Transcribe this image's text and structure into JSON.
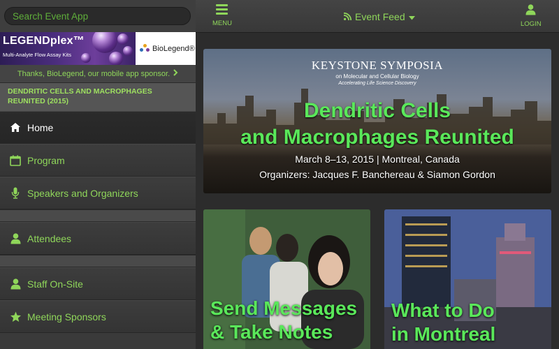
{
  "sidebar": {
    "search": {
      "placeholder": "Search Event App"
    },
    "sponsor": {
      "brand": "LEGENDplex™",
      "tagline": "Multi-Analyte Flow Assay Kits",
      "company": "BioLegend®",
      "thanks": "Thanks, BioLegend, our mobile app sponsor.",
      "thanks_icon": "chevron-right-icon"
    },
    "event_title": "DENDRITIC CELLS AND MACROPHAGES REUNITED (2015)",
    "nav": [
      {
        "label": "Home",
        "icon": "home-icon",
        "active": true
      },
      {
        "label": "Program",
        "icon": "calendar-icon"
      },
      {
        "label": "Speakers and Organizers",
        "icon": "microphone-icon"
      },
      {
        "label": "Attendees",
        "icon": "person-icon"
      },
      {
        "label": "Staff On-Site",
        "icon": "person-icon"
      },
      {
        "label": "Meeting Sponsors",
        "icon": "star-icon"
      }
    ]
  },
  "topbar": {
    "menu_label": "MENU",
    "feed_label": "Event Feed",
    "login_label": "LOGIN"
  },
  "hero": {
    "org": "KEYSTONE SYMPOSIA",
    "org_sub": "on Molecular and Cellular Biology",
    "org_tag": "Accelerating Life Science Discovery",
    "title_line1": "Dendritic Cells",
    "title_line2": "and Macrophages Reunited",
    "dates": "March 8–13, 2015 | Montreal, Canada",
    "organizers": "Organizers: Jacques F. Banchereau & Siamon Gordon"
  },
  "cards": [
    {
      "line1": "Send Messages",
      "line2": "& Take Notes"
    },
    {
      "line1": "What to Do",
      "line2": "in Montreal"
    }
  ],
  "colors": {
    "accent": "#8fd65a",
    "headline": "#5ae85a",
    "bar": "#3a3a3a"
  }
}
